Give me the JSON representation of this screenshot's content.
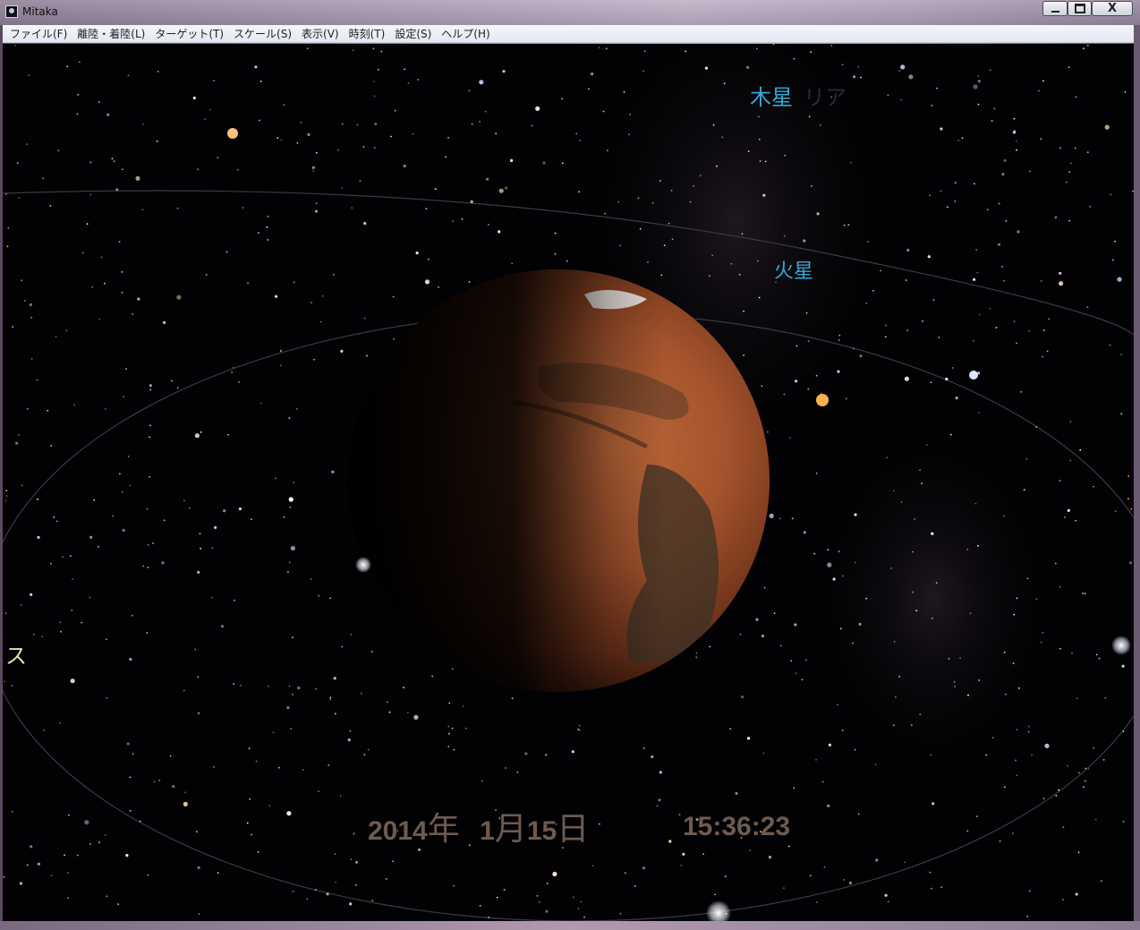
{
  "window": {
    "title": "Mitaka",
    "app_icon": "mitaka-app-icon",
    "controls": {
      "minimize_icon": "minimize-icon",
      "maximize_icon": "maximize-icon",
      "close_label": "X"
    }
  },
  "menu": {
    "items": [
      {
        "label": "ファイル(F)"
      },
      {
        "label": "離陸・着陸(L)"
      },
      {
        "label": "ターゲット(T)"
      },
      {
        "label": "スケール(S)"
      },
      {
        "label": "表示(V)"
      },
      {
        "label": "時刻(T)"
      },
      {
        "label": "設定(S)"
      },
      {
        "label": "ヘルプ(H)"
      }
    ]
  },
  "sky": {
    "labels": {
      "jupiter": "木星",
      "jupiter_faint": "リア",
      "mars": "火星",
      "left_edge": "ス"
    },
    "colors": {
      "label": "#36a8d8",
      "date": "#6f5a4f",
      "background": "#020204"
    }
  },
  "datetime": {
    "year": "2014",
    "year_unit": "年",
    "month": "1",
    "month_unit": "月",
    "day": "15",
    "day_unit": "日",
    "time": "15:36:23"
  }
}
